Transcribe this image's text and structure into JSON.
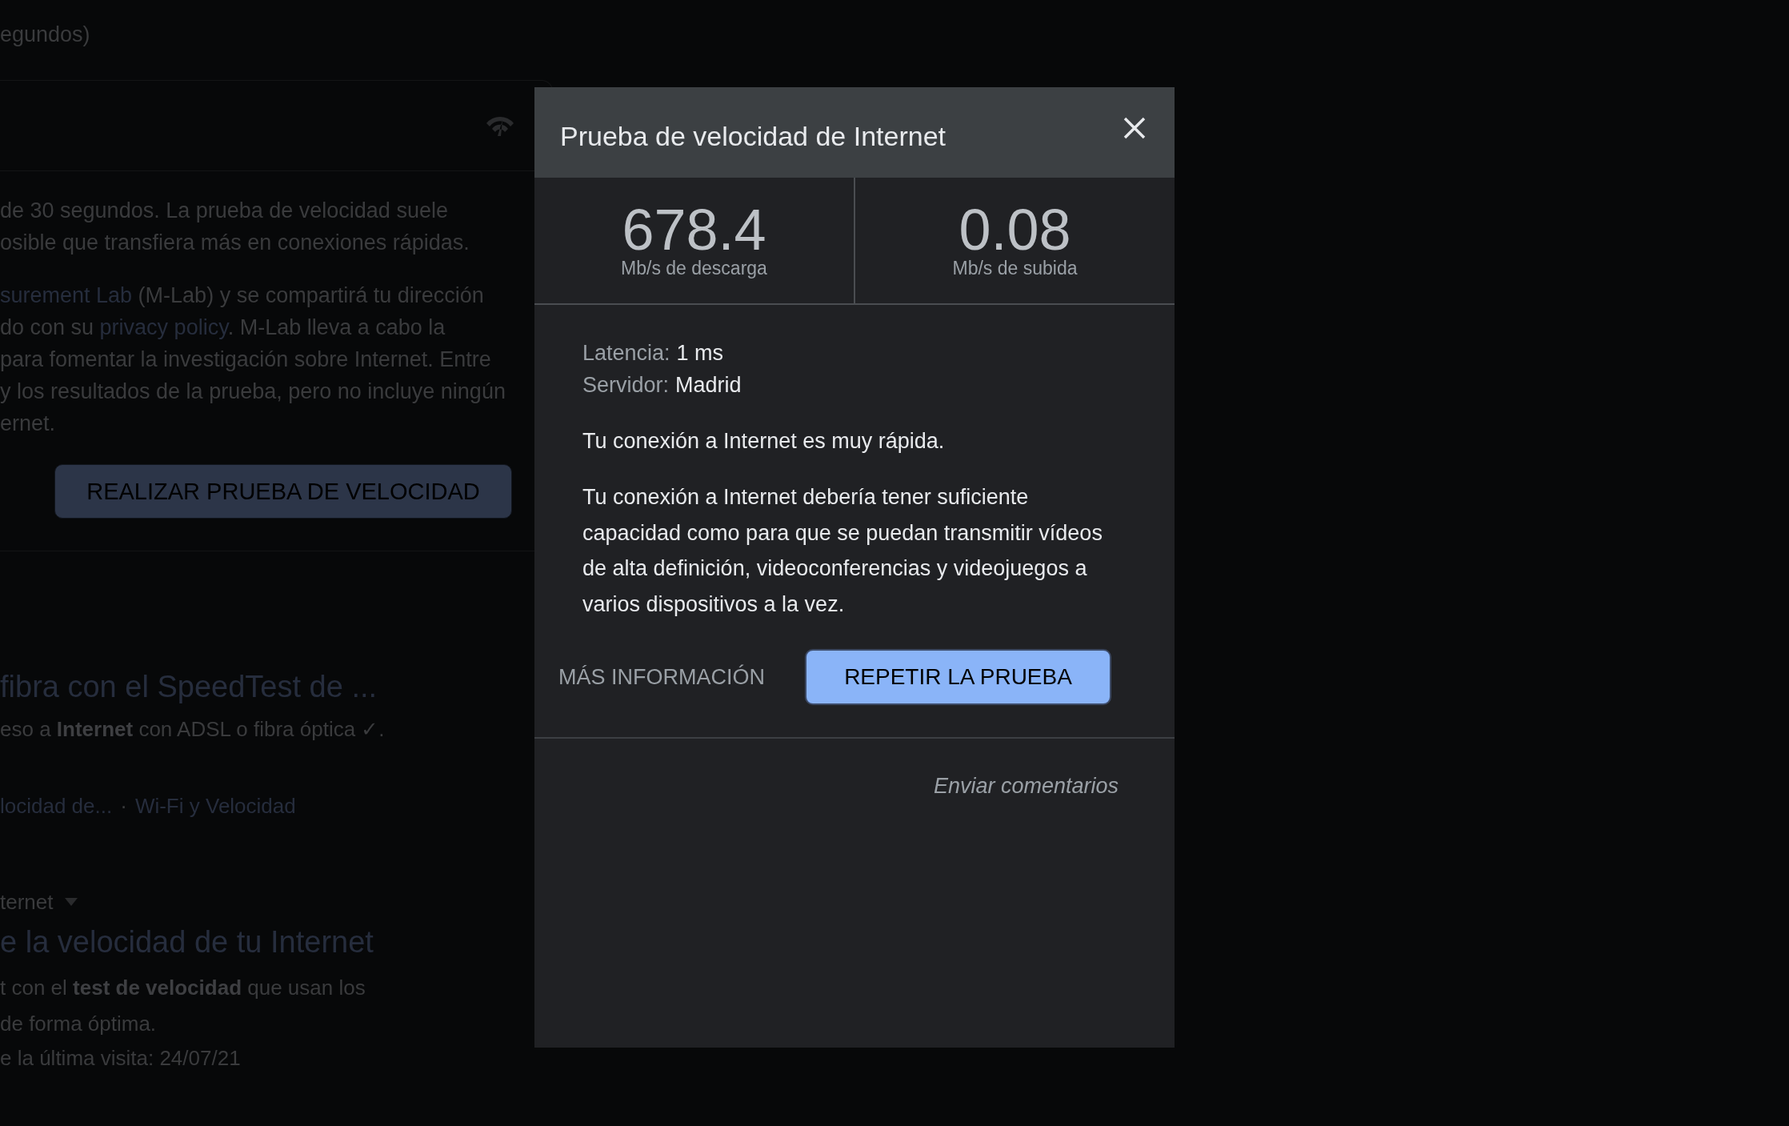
{
  "background": {
    "top_text": "egundos)",
    "card": {
      "paragraphs": [
        [
          [
            {
              "kind": "plain",
              "text": "de 30 segundos. La prueba de velocidad suele"
            }
          ],
          [
            {
              "kind": "plain",
              "text": "osible que transfiera más en conexiones rápidas."
            }
          ]
        ],
        [
          [
            {
              "kind": "link",
              "text": "surement Lab"
            },
            {
              "kind": "plain",
              "text": " (M-Lab) y se compartirá tu dirección"
            }
          ],
          [
            {
              "kind": "plain",
              "text": "do con su "
            },
            {
              "kind": "link",
              "text": "privacy policy"
            },
            {
              "kind": "plain",
              "text": ". M-Lab lleva a cabo la"
            }
          ],
          [
            {
              "kind": "plain",
              "text": "para fomentar la investigación sobre Internet. Entre"
            }
          ],
          [
            {
              "kind": "plain",
              "text": "y los resultados de la prueba, pero no incluye ningún"
            }
          ],
          [
            {
              "kind": "plain",
              "text": "ernet."
            }
          ]
        ]
      ],
      "button": "REALIZAR PRUEBA DE VELOCIDAD"
    },
    "results": [
      {
        "title": "fibra con el SpeedTest de ...",
        "snippet_lines": [
          "eso a **Internet** con ADSL o fibra óptica ✓."
        ],
        "links": [
          "locidad de...",
          "Wi-Fi y Velocidad"
        ],
        "separator": "·"
      },
      {
        "source": "ternet",
        "title": "e la velocidad de tu Internet",
        "snippet_lines": [
          "t con el **test de velocidad** que usan los",
          "de forma óptima."
        ],
        "date": "e la última visita: 24/07/21"
      }
    ]
  },
  "dialog": {
    "title": "Prueba de velocidad de Internet",
    "stats": [
      {
        "value": "678.4",
        "label": "Mb/s de descarga"
      },
      {
        "value": "0.08",
        "label": "Mb/s de subida"
      }
    ],
    "details": [
      {
        "label": "Latencia:",
        "value": "1 ms"
      },
      {
        "label": "Servidor:",
        "value": "Madrid"
      }
    ],
    "summary": "Tu conexión a Internet es muy rápida.",
    "description": "Tu conexión a Internet debería tener suficiente capacidad como para que se puedan transmitir vídeos de alta definición, videoconferencias y videojuegos a varios dispositivos a la vez.",
    "secondary_button": "MÁS INFORMACIÓN",
    "primary_button": "REPETIR LA PRUEBA",
    "feedback_link": "Enviar comentarios"
  }
}
